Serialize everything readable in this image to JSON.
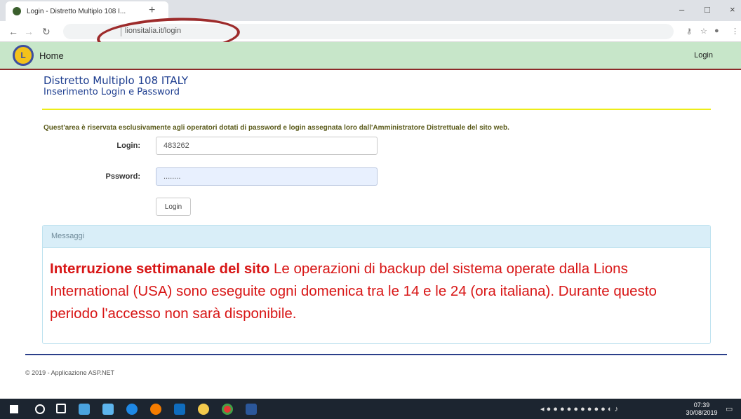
{
  "browser": {
    "tab_title": "Login - Distretto Multiplo 108 I...",
    "new_tab_label": "+",
    "address": "lionsitalia.it/login",
    "minimize_label": "–",
    "restore_label": "□",
    "close_label": "×"
  },
  "nav": {
    "logo_text": "L",
    "home_label": "Home",
    "login_label": "Login",
    "bar_color": "#c7e6c9"
  },
  "header": {
    "title": "Distretto Multiplo 108 ITALY",
    "subtitle": "Inserimento Login e Password"
  },
  "notice": "Quest'area è riservata esclusivamente agli operatori dotati di password e login assegnata loro dall'Amministratore Distrettuale del sito web.",
  "form": {
    "login_label": "Login:",
    "login_value": "483262",
    "password_label": "Pssword:",
    "password_value": "........",
    "submit_label": "Login"
  },
  "messages": {
    "heading": "Messaggi",
    "bold_text": "Interruzione settimanale del sito",
    "body_text": " Le operazioni di backup del sistema operate dalla Lions International (USA) sono eseguite ogni domenica tra le 14 e le 24 (ora italiana). Durante questo periodo l'accesso non sarà disponibile.",
    "text_color": "#d81616"
  },
  "footer": {
    "copyright": "© 2019 - Applicazione ASP.NET"
  },
  "taskbar": {
    "time": "07:39",
    "date": "30/08/2019"
  },
  "annotation_color": "#9d2b2b"
}
